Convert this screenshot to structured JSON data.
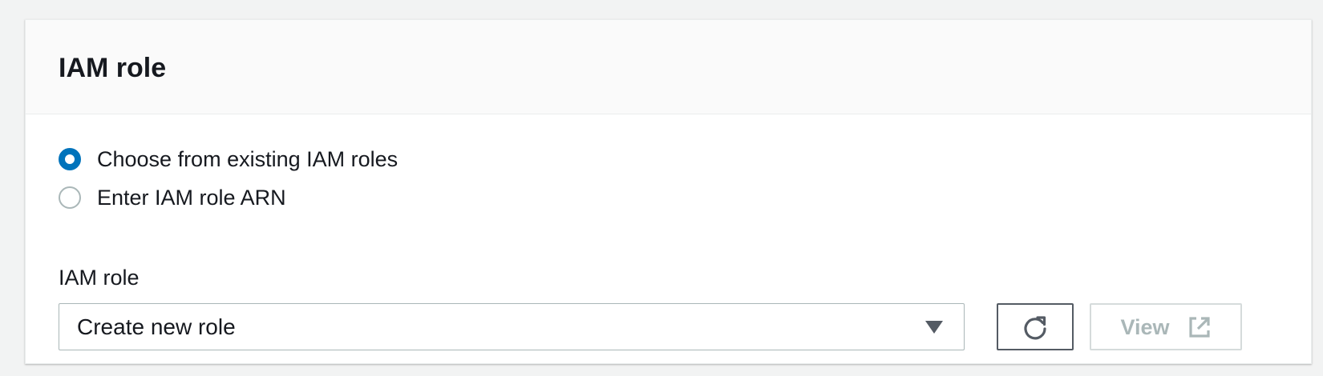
{
  "panel": {
    "title": "IAM role"
  },
  "options": [
    {
      "label": "Choose from existing IAM roles",
      "selected": true
    },
    {
      "label": "Enter IAM role ARN",
      "selected": false
    }
  ],
  "field": {
    "label": "IAM role",
    "selected_value": "Create new role"
  },
  "buttons": {
    "refresh_icon": "refresh-icon",
    "view_label": "View",
    "view_icon": "external-link-icon",
    "view_disabled": true
  },
  "colors": {
    "accent": "#0073bb",
    "text": "#16191f",
    "disabled": "#aab7b8",
    "border": "#aab7b8"
  }
}
